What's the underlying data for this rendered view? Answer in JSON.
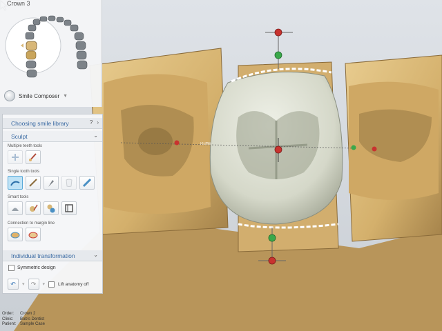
{
  "window": {
    "title": "Crown 3"
  },
  "composer": {
    "label": "Smile Composer",
    "arrow": "▼"
  },
  "library": {
    "title": "Choosing smile library",
    "help": "?",
    "next": "›"
  },
  "sculpt": {
    "title": "Sculpt",
    "multiple_label": "Multiple teeth tools",
    "single_label": "Single tooth tools",
    "smart_label": "Smart tools",
    "connection_label": "Connection to margin line"
  },
  "transform": {
    "title": "Individual transformation",
    "symmetric_label": "Symmetric design"
  },
  "footer": {
    "lift_label": "Lift anatomy off"
  },
  "order": {
    "order_label": "Order:",
    "order_value": "Crown 2",
    "clinic_label": "Clinic:",
    "clinic_value": "Bob's Dentist",
    "patient_label": "Patient:",
    "patient_value": "Sample Case"
  },
  "cursor_label": "Ruffle",
  "colors": {
    "accent": "#3a6aa3",
    "tooth_gold": "#d8b777",
    "crown": "#e2e4d8",
    "handle_red": "#c8332f",
    "handle_green": "#3aa84a"
  },
  "icons": [
    "chevron-down-icon",
    "help-icon",
    "arrow-right-icon",
    "undo-icon",
    "redo-icon",
    "smile-icon"
  ]
}
